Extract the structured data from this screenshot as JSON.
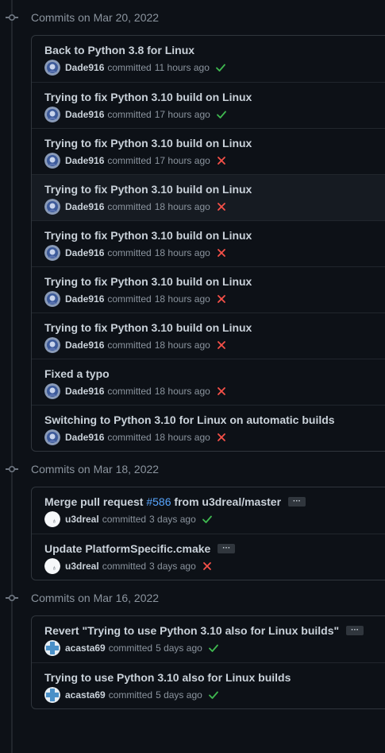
{
  "groups": [
    {
      "title": "Commits on Mar 20, 2022",
      "commits": [
        {
          "message": "Back to Python 3.8 for Linux",
          "author": "Dade916",
          "verb": "committed",
          "time": "11 hours ago",
          "status": "success",
          "avatar": "dade"
        },
        {
          "message": "Trying to fix Python 3.10 build on Linux",
          "author": "Dade916",
          "verb": "committed",
          "time": "17 hours ago",
          "status": "success",
          "avatar": "dade"
        },
        {
          "message": "Trying to fix Python 3.10 build on Linux",
          "author": "Dade916",
          "verb": "committed",
          "time": "17 hours ago",
          "status": "failure",
          "avatar": "dade"
        },
        {
          "message": "Trying to fix Python 3.10 build on Linux",
          "author": "Dade916",
          "verb": "committed",
          "time": "18 hours ago",
          "status": "failure",
          "avatar": "dade"
        },
        {
          "message": "Trying to fix Python 3.10 build on Linux",
          "author": "Dade916",
          "verb": "committed",
          "time": "18 hours ago",
          "status": "failure",
          "avatar": "dade"
        },
        {
          "message": "Trying to fix Python 3.10 build on Linux",
          "author": "Dade916",
          "verb": "committed",
          "time": "18 hours ago",
          "status": "failure",
          "avatar": "dade"
        },
        {
          "message": "Trying to fix Python 3.10 build on Linux",
          "author": "Dade916",
          "verb": "committed",
          "time": "18 hours ago",
          "status": "failure",
          "avatar": "dade"
        },
        {
          "message": "Fixed a typo",
          "author": "Dade916",
          "verb": "committed",
          "time": "18 hours ago",
          "status": "failure",
          "avatar": "dade"
        },
        {
          "message": "Switching to Python 3.10 for Linux on automatic builds",
          "author": "Dade916",
          "verb": "committed",
          "time": "18 hours ago",
          "status": "failure",
          "avatar": "dade"
        }
      ]
    },
    {
      "title": "Commits on Mar 18, 2022",
      "commits": [
        {
          "message_parts": [
            "Merge pull request ",
            "#586",
            " from u3dreal/master"
          ],
          "author": "u3dreal",
          "verb": "committed",
          "time": "3 days ago",
          "status": "success",
          "avatar": "u3d",
          "has_ellipsis": true
        },
        {
          "message": "Update PlatformSpecific.cmake",
          "author": "u3dreal",
          "verb": "committed",
          "time": "3 days ago",
          "status": "failure",
          "avatar": "u3d",
          "has_ellipsis": true
        }
      ]
    },
    {
      "title": "Commits on Mar 16, 2022",
      "commits": [
        {
          "message": "Revert \"Trying to use Python 3.10 also for Linux builds\"",
          "author": "acasta69",
          "verb": "committed",
          "time": "5 days ago",
          "status": "success",
          "avatar": "acasta",
          "has_ellipsis": true
        },
        {
          "message": "Trying to use Python 3.10 also for Linux builds",
          "author": "acasta69",
          "verb": "committed",
          "time": "5 days ago",
          "status": "success",
          "avatar": "acasta"
        }
      ]
    }
  ],
  "ellipsis_label": "···",
  "icons": {
    "commit_node": "git-commit-icon",
    "success": "check-icon",
    "failure": "x-icon"
  },
  "colors": {
    "success": "#3fb950",
    "failure": "#f85149",
    "link": "#58a6ff"
  },
  "hover_row": {
    "group": 0,
    "index": 3
  }
}
